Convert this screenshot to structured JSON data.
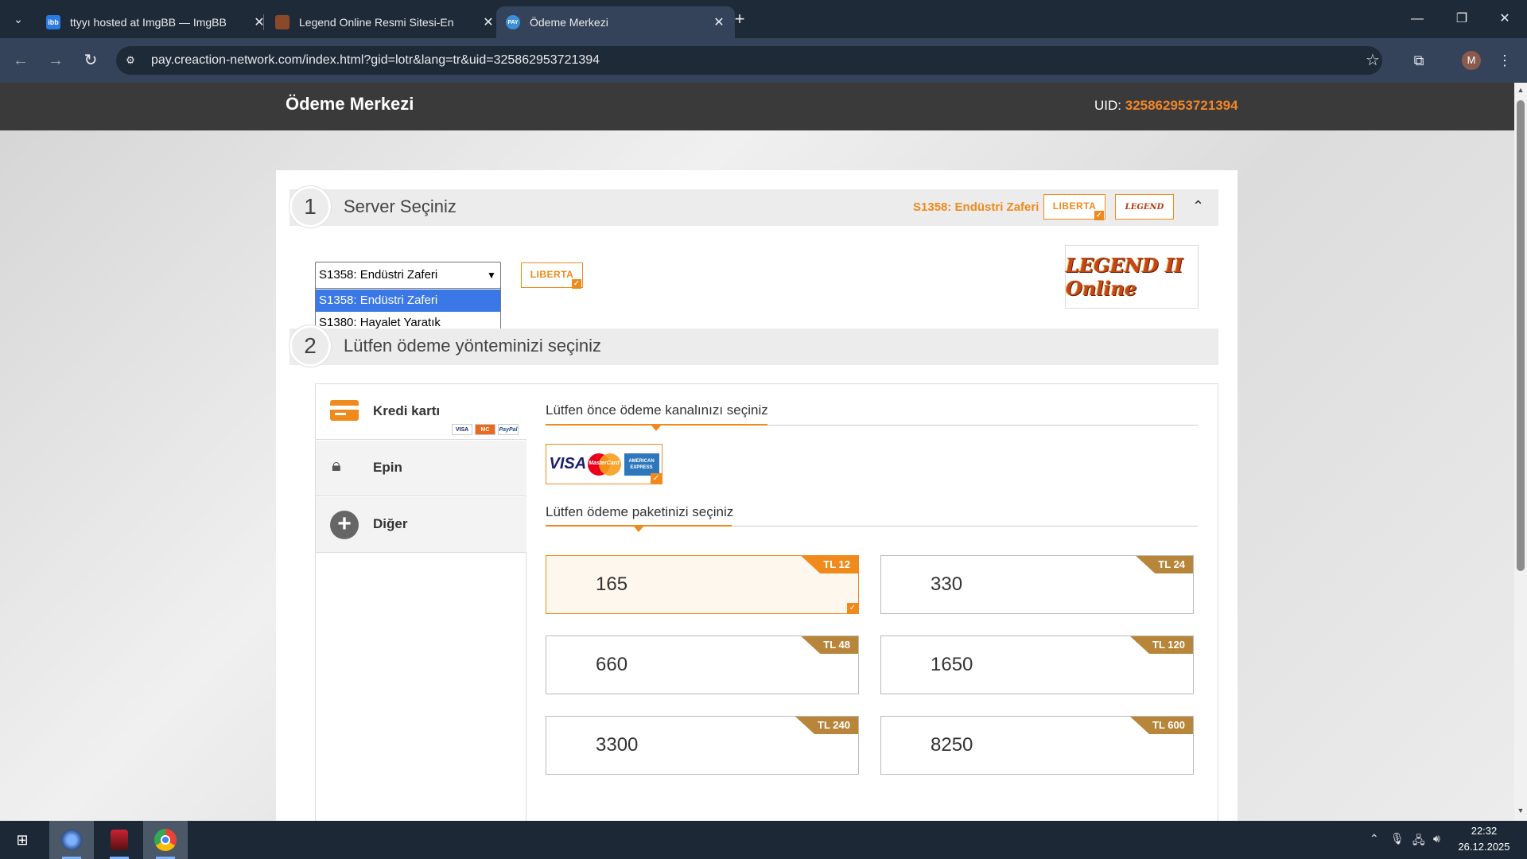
{
  "browser": {
    "tabs": [
      {
        "title": "ttyyı hosted at ImgBB — ImgBB",
        "favicon": "imgbb-icon",
        "favicon_text": "ibb"
      },
      {
        "title": "Legend Online Resmi Sitesi-En",
        "favicon": "legend-online-icon",
        "favicon_text": ""
      },
      {
        "title": "Ödeme Merkezi",
        "favicon": "pay-icon",
        "favicon_text": "PAY"
      }
    ],
    "active_tab": 2,
    "url": "pay.creaction-network.com/index.html?gid=lotr&lang=tr&uid=325862953721394",
    "profile_initial": "M"
  },
  "header": {
    "title": "Ödeme Merkezi",
    "uid_label": "UID:",
    "uid_value": "325862953721394"
  },
  "step1": {
    "number": "1",
    "label": "Server Seçiniz",
    "selected_server": "S1358: Endüstri Zaferi",
    "badge": "LIBERTA",
    "mini_logo": "LEGEND",
    "select_value": "S1358: Endüstri Zaferi",
    "options": [
      "S1358: Endüstri Zaferi",
      "S1380: Hayalet Yaratık"
    ],
    "highlighted_option": 0,
    "game_logo": "LEGEND II Online"
  },
  "step2": {
    "number": "2",
    "label": "Lütfen ödeme yönteminizi seçiniz"
  },
  "methods": [
    {
      "label": "Kredi kartı",
      "icon": "credit-card-icon",
      "active": true,
      "cards": [
        "VISA",
        "MC",
        "PayPal"
      ]
    },
    {
      "label": "Epin",
      "icon": "lock-icon",
      "active": false
    },
    {
      "label": "Diğer",
      "icon": "plus-icon",
      "active": false
    }
  ],
  "channel": {
    "title": "Lütfen önce ödeme kanalınızı seçiniz",
    "visa": "VISA",
    "mastercard": "MasterCard",
    "amex": "AMERICAN EXPRESS"
  },
  "package_section": {
    "title": "Lütfen ödeme paketinizi seçiniz",
    "packages": [
      {
        "amount": "165",
        "price": "TL 12",
        "selected": true
      },
      {
        "amount": "330",
        "price": "TL 24",
        "selected": false
      },
      {
        "amount": "660",
        "price": "TL 48",
        "selected": false
      },
      {
        "amount": "1650",
        "price": "TL 120",
        "selected": false
      },
      {
        "amount": "3300",
        "price": "TL 240",
        "selected": false
      },
      {
        "amount": "8250",
        "price": "TL 600",
        "selected": false
      }
    ]
  },
  "taskbar": {
    "time": "22:32",
    "date": "26.12.2025"
  },
  "colors": {
    "accent": "#f08a1c",
    "header_bg": "#3a3a3a",
    "price_tag": "#b8863a"
  }
}
